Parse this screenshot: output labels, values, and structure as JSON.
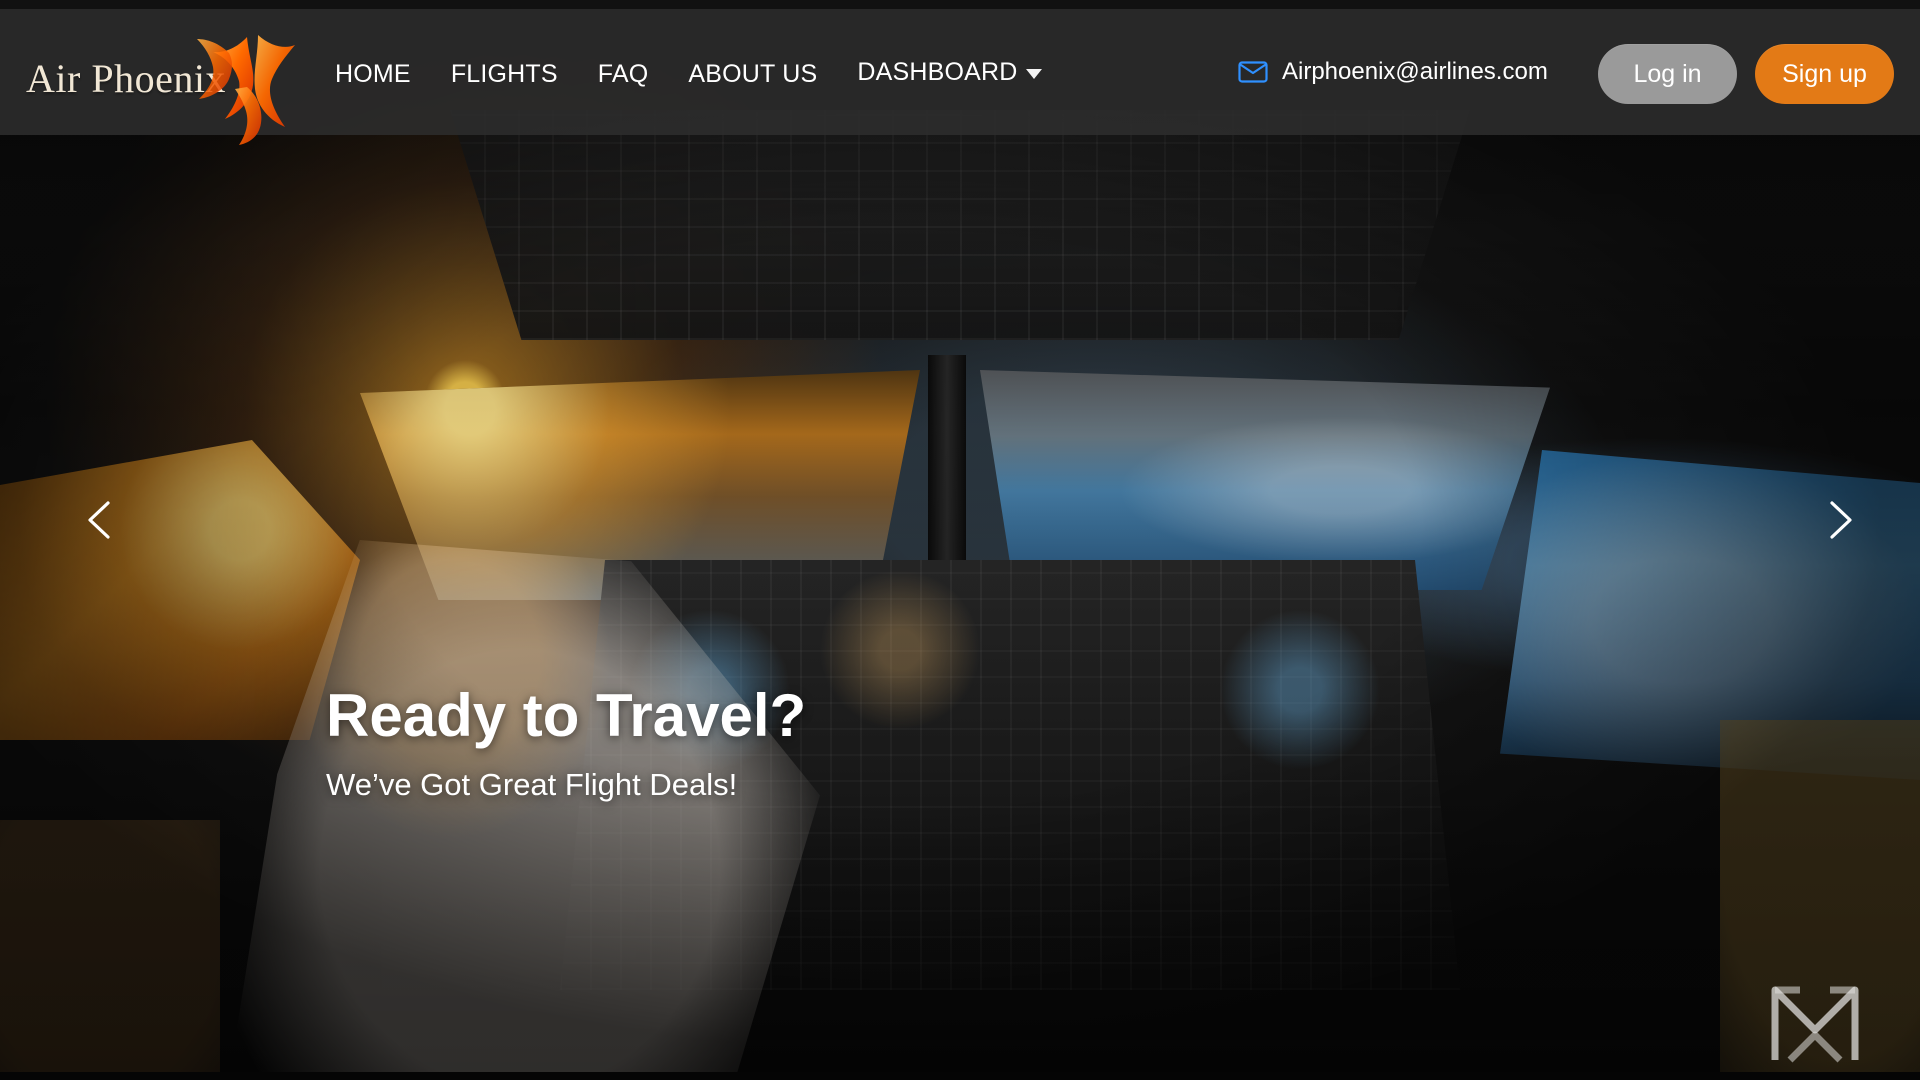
{
  "brand": {
    "name": "Air Phoenix",
    "logo_icon": "phoenix-icon"
  },
  "nav": {
    "items": [
      {
        "label": "HOME"
      },
      {
        "label": "FLIGHTS"
      },
      {
        "label": "FAQ"
      },
      {
        "label": "ABOUT US"
      },
      {
        "label": "DASHBOARD",
        "icon": "chevron-down-icon"
      }
    ]
  },
  "contact": {
    "email": "Airphoenix@airlines.com",
    "icon": "mail-icon"
  },
  "auth": {
    "login_label": "Log in",
    "signup_label": "Sign up"
  },
  "hero": {
    "title": "Ready to Travel?",
    "subtitle": "We’ve Got Great Flight Deals!"
  },
  "carousel": {
    "prev_icon": "chevron-left-icon",
    "next_icon": "chevron-right-icon"
  },
  "colors": {
    "header_bg": "#2d2d2d",
    "accent_orange": "#e37a16",
    "login_gray": "#9a9a9a",
    "email_icon_blue": "#2f90ff"
  }
}
